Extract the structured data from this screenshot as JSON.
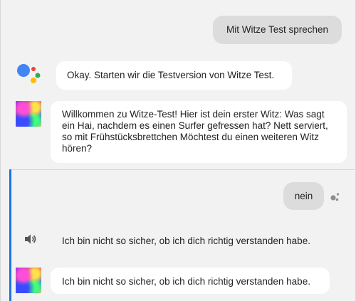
{
  "conversation": {
    "user_request": "Mit Witze Test sprechen",
    "assistant_reply": "Okay. Starten wir die Testversion von Witze Test.",
    "action_welcome": "Willkommen zu Witze-Test! Hier ist dein erster Witz: Was sagt ein Hai, nachdem es einen Surfer gefressen hat? Nett serviert, so mit Frühstücksbrettchen Möchtest du einen weiteren Witz hören?",
    "user_reply": "nein",
    "audio_response": "Ich bin nicht so sicher, ob ich dich richtig verstanden habe.",
    "action_response": "Ich bin nicht so sicher, ob ich dich richtig verstanden habe."
  },
  "icons": {
    "assistant": "google-assistant-logo-icon",
    "avatar": "action-avatar-icon",
    "speaker": "speaker-icon",
    "assistant_small": "assistant-dots-icon"
  },
  "colors": {
    "accent": "#1a73e8",
    "assistant_blue": "#4285f4",
    "assistant_red": "#ea4335",
    "assistant_yellow": "#fbbc05",
    "assistant_green": "#34a853"
  }
}
